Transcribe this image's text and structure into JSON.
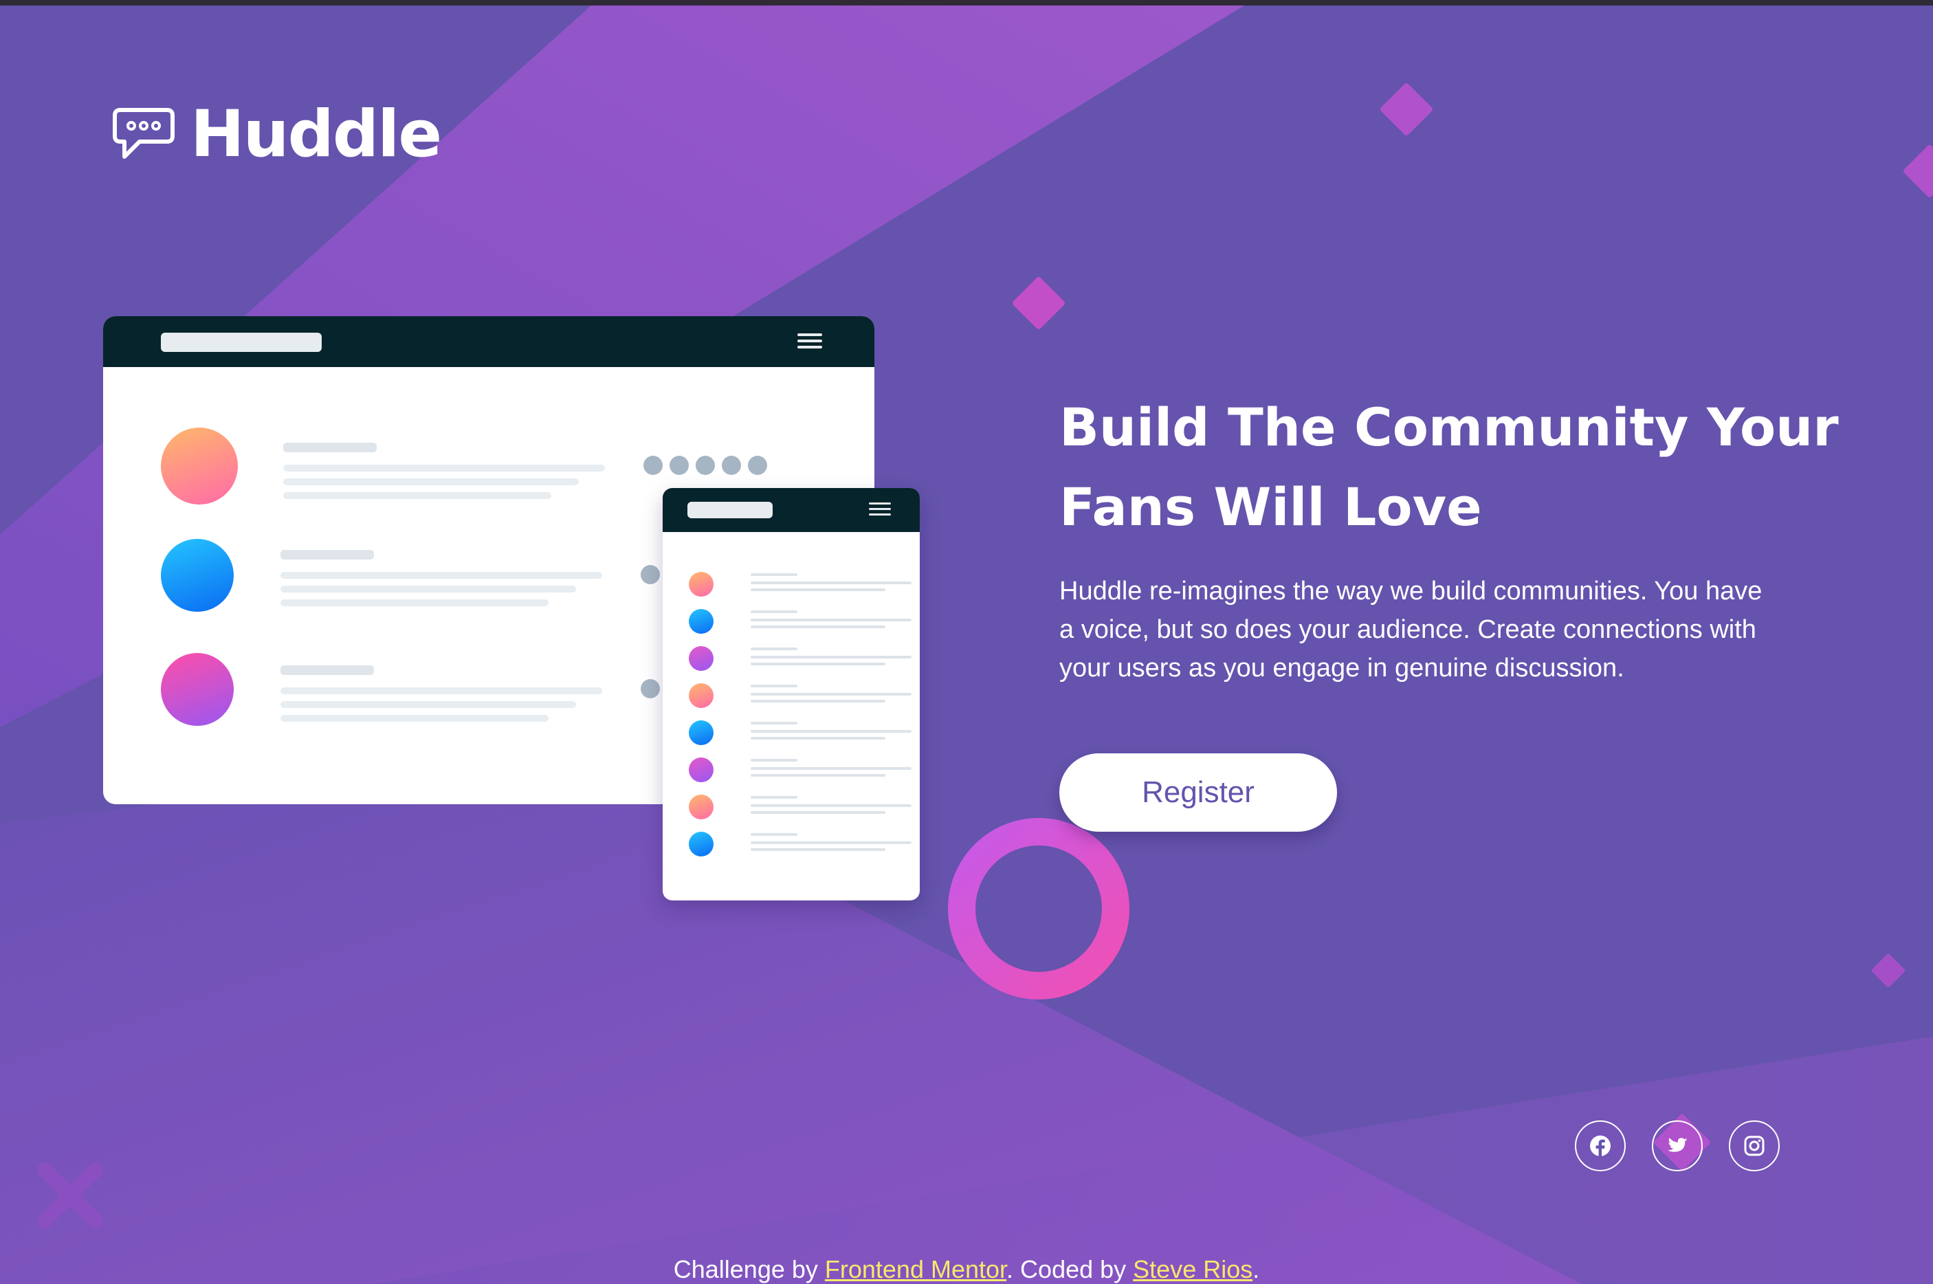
{
  "brand": {
    "name": "Huddle"
  },
  "hero": {
    "headline_line1": "Build The Community Your",
    "headline_line2": "Fans Will Love",
    "description": "Huddle re-imagines the way we build communities. You have a voice, but so does your audience. Create connections with your users as you engage in genuine discussion.",
    "register_label": "Register"
  },
  "socials": [
    {
      "icon": "facebook-icon"
    },
    {
      "icon": "twitter-icon"
    },
    {
      "icon": "instagram-icon"
    }
  ],
  "footer": {
    "challenge_prefix": "Challenge by ",
    "challenge_link": "Frontend Mentor",
    "coded_prefix": ". Coded by ",
    "coded_link": "Steve Rios",
    "suffix": "."
  },
  "colors": {
    "background": "#6553ad",
    "accent_pink": "#e852c6",
    "accent_purple": "#b05be0",
    "dark_bar": "#06242b",
    "footer_link": "#f9e76b"
  }
}
